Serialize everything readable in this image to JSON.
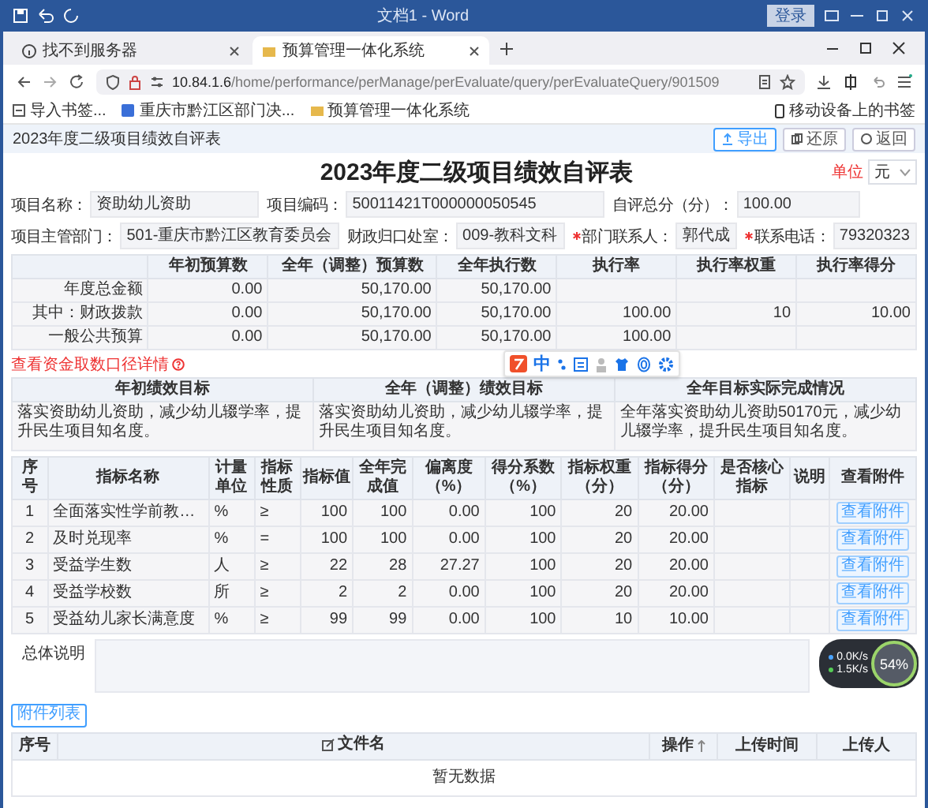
{
  "word_window": {
    "title": "文档1 - Word",
    "login_button": "登录"
  },
  "browser": {
    "tabs": [
      {
        "label": "找不到服务器",
        "selected": false
      },
      {
        "label": "预算管理一体化系统",
        "selected": true
      }
    ],
    "address": "**10.84.1.6**/home/performance/perManage/perEvaluate/query/perEvaluateQuery/901509",
    "bookmarks": [
      "导入书签...",
      "重庆市黔江区部门决...",
      "预算管理一体化系统"
    ],
    "mobile_bookmarks": "移动设备上的书签"
  },
  "breadcrumb": "2023年度二级项目绩效自评表",
  "actions": [
    {
      "label": "导出",
      "kind": "primary"
    },
    {
      "label": "还原",
      "kind": "plain"
    },
    {
      "label": "返回",
      "kind": "plain"
    }
  ],
  "title": "2023年度二级项目绩效自评表",
  "unit": {
    "label": "单位",
    "value": "元"
  },
  "field_rows": [
    [
      {
        "label": "项目名称：",
        "value": "资助幼儿资助",
        "required": false
      },
      {
        "label": "项目编码：",
        "value": "50011421T000000050545",
        "required": false
      },
      {
        "label": "自评总分（分）：",
        "value": "100.00",
        "required": false
      }
    ],
    [
      {
        "label": "项目主管部门：",
        "value": "501-重庆市黔江区教育委员会",
        "required": false
      },
      {
        "label": "财政归口处室：",
        "value": "009-教科文科",
        "required": false
      },
      {
        "label": "部门联系人：",
        "value": "郭代成",
        "required": true
      },
      {
        "label": "联系电话：",
        "value": "79320323",
        "required": true
      }
    ]
  ],
  "budget_table": {
    "columns": [
      "年初预算数",
      "全年（调整）预算数",
      "全年执行数",
      "执行率",
      "执行率权重",
      "执行率得分"
    ],
    "rows": [
      {
        "label": "年度总金额",
        "cells": [
          "0.00",
          "50,170.00",
          "50,170.00",
          null,
          null,
          null
        ]
      },
      {
        "label": "其中：财政拨款",
        "cells": [
          "0.00",
          "50,170.00",
          "50,170.00",
          "100.00",
          "10",
          "10.00"
        ]
      },
      {
        "label": "一般公共预算",
        "cells": [
          "0.00",
          "50,170.00",
          "50,170.00",
          "100.00",
          null,
          null
        ]
      }
    ]
  },
  "funding_link": "查看资金取数口径详情",
  "ime_toolbar": {
    "mode": "中"
  },
  "goals_table": {
    "columns": [
      "年初绩效目标",
      "全年（调整）绩效目标",
      "全年目标实际完成情况"
    ],
    "texts": [
      "落实资助幼儿资助，减少幼儿辍学率，提升民生项目知名度。",
      "落实资助幼儿资助，减少幼儿辍学率，提升民生项目知名度。",
      "全年落实资助幼儿资助50170元，减少幼儿辍学率，提升民生项目知名度。"
    ]
  },
  "indicator_table": {
    "columns": [
      "序号",
      "指标名称",
      "计量单位",
      "指标性质",
      "指标值",
      "全年完成值",
      "偏离度（%）",
      "得分系数（%）",
      "指标权重（分）",
      "指标得分（分）",
      "是否核心指标",
      "说明",
      "查看附件"
    ],
    "rows": [
      {
        "no": "1",
        "name": "全面落实性学前教…",
        "unit": "%",
        "nature": "≥",
        "value": "100",
        "actual": "100",
        "deviation": "0.00",
        "coefficient": "100",
        "weight": "20",
        "score": "20.00",
        "attachment_button": "查看附件"
      },
      {
        "no": "2",
        "name": "及时兑现率",
        "unit": "%",
        "nature": "=",
        "value": "100",
        "actual": "100",
        "deviation": "0.00",
        "coefficient": "100",
        "weight": "20",
        "score": "20.00",
        "attachment_button": "查看附件"
      },
      {
        "no": "3",
        "name": "受益学生数",
        "unit": "人",
        "nature": "≥",
        "value": "22",
        "actual": "28",
        "deviation": "27.27",
        "coefficient": "100",
        "weight": "20",
        "score": "20.00",
        "attachment_button": "查看附件"
      },
      {
        "no": "4",
        "name": "受益学校数",
        "unit": "所",
        "nature": "≥",
        "value": "2",
        "actual": "2",
        "deviation": "0.00",
        "coefficient": "100",
        "weight": "20",
        "score": "20.00",
        "attachment_button": "查看附件"
      },
      {
        "no": "5",
        "name": "受益幼儿家长满意度",
        "unit": "%",
        "nature": "≥",
        "value": "99",
        "actual": "99",
        "deviation": "0.00",
        "coefficient": "100",
        "weight": "10",
        "score": "10.00",
        "attachment_button": "查看附件"
      }
    ]
  },
  "summary": {
    "label": "总体说明"
  },
  "net_monitor": {
    "upload": "0.0K/s",
    "download": "1.5K/s",
    "usage": "54%"
  },
  "attachments": {
    "button": "附件列表",
    "columns": [
      "序号",
      "文件名",
      "操作",
      "上传时间",
      "上传人"
    ],
    "empty_text": "暂无数据"
  }
}
